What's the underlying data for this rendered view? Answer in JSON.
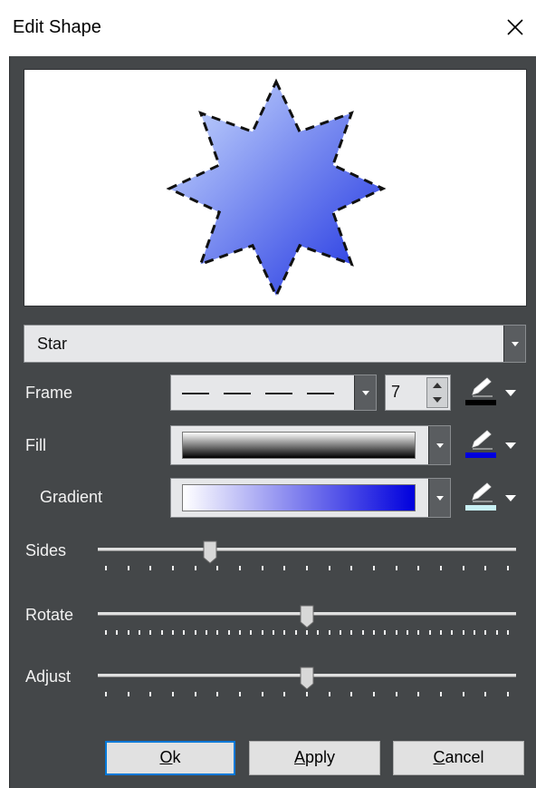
{
  "window": {
    "title": "Edit Shape"
  },
  "shape_select": {
    "value": "Star"
  },
  "labels": {
    "frame": "Frame",
    "fill": "Fill",
    "gradient": "Gradient",
    "sides": "Sides",
    "rotate": "Rotate",
    "adjust": "Adjust"
  },
  "frame": {
    "style": "dashed",
    "width": "7",
    "color": "#000000"
  },
  "fill": {
    "gradient_from": "#ffffff",
    "gradient_to": "#000000",
    "color": "#0000dd"
  },
  "gradient": {
    "gradient_from": "#ffffff",
    "gradient_to": "#0000dd",
    "color": "#c8f0f4"
  },
  "preview": {
    "shape": "star",
    "points": 8,
    "fill_from": "#cfe0ff",
    "fill_to": "#1a2ee0",
    "stroke": "#111111"
  },
  "sliders": {
    "sides": {
      "level": 0.26,
      "ticks": 19
    },
    "rotate": {
      "level": 0.5,
      "ticks": 37
    },
    "adjust": {
      "level": 0.5,
      "ticks": 19
    }
  },
  "buttons": {
    "ok": {
      "mnemonic": "O",
      "rest": "k"
    },
    "apply": {
      "mnemonic": "A",
      "rest": "pply"
    },
    "cancel": {
      "mnemonic": "C",
      "rest": "ancel"
    }
  },
  "icons": {
    "close": "close-icon",
    "pen": "pen-icon",
    "dropdown": "chevron-down-icon"
  }
}
